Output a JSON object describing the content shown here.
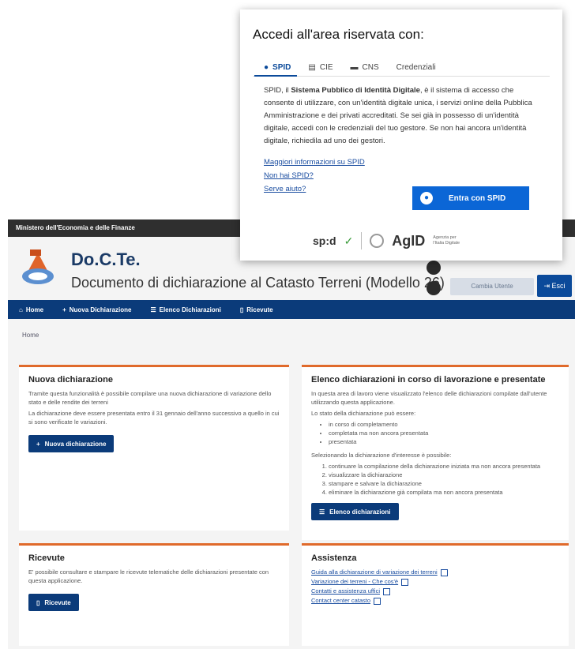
{
  "popup": {
    "title": "Accedi all'area riservata con:",
    "tabs": [
      {
        "label": "SPID",
        "icon": "user-circle-icon"
      },
      {
        "label": "CIE",
        "icon": "id-card-icon"
      },
      {
        "label": "CNS",
        "icon": "card-icon"
      },
      {
        "label": "Credenziali",
        "icon": ""
      }
    ],
    "text_pre": "SPID, il ",
    "text_bold": "Sistema Pubblico di Identità Digitale",
    "text_post": ", è il sistema di accesso che consente di utilizzare, con un'identità digitale unica, i servizi online della Pubblica Amministrazione e dei privati accreditati. Se sei già in possesso di un'identità digitale, accedi con le credenziali del tuo gestore. Se non hai ancora un'identità digitale, richiedila ad uno dei gestori.",
    "links": [
      "Maggiori informazioni su SPID",
      "Non hai SPID?",
      "Serve aiuto?"
    ],
    "login_button": "Entra con SPID",
    "spid_logo": "sp:d",
    "agid_logo": "AgID",
    "agid_sub": "Agenzia per l'Italia Digitale"
  },
  "ministry": "Ministero dell'Economia e delle Finanze",
  "app": {
    "title": "Do.C.Te.",
    "subtitle": "Documento di dichiarazione al Catasto Terreni (Modello 26)",
    "cambia_utente": "Cambia Utente",
    "esci": "Esci"
  },
  "nav": [
    "Home",
    "Nuova Dichiarazione",
    "Elenco Dichiarazioni",
    "Ricevute"
  ],
  "breadcrumb": "Home",
  "cards": {
    "nuova": {
      "title": "Nuova dichiarazione",
      "p1": "Tramite questa funzionalità è possibile compilare una nuova dichiarazione di variazione dello stato e delle rendite dei terreni",
      "p2": "La dichiarazione deve essere presentata entro il 31 gennaio dell'anno successivo a quello in cui si sono verificate le variazioni.",
      "button": "Nuova dichiarazione"
    },
    "elenco": {
      "title": "Elenco dichiarazioni in corso di lavorazione e presentate",
      "p1": "In questa area di lavoro viene visualizzato l'elenco delle dichiarazioni compilate dall'utente utilizzando questa applicazione.",
      "p2": "Lo stato della dichiarazione può essere:",
      "states": [
        "in corso di completamento",
        "completata ma non ancora presentata",
        "presentata"
      ],
      "p3": "Selezionando la dichiarazione d'interesse è possibile:",
      "actions": [
        "continuare la compilazione della dichiarazione iniziata ma non ancora presentata",
        "visualizzare la dichiarazione",
        "stampare e salvare la dichiarazione",
        "eliminare la dichiarazione già compilata ma non ancora presentata"
      ],
      "button": "Elenco dichiarazioni"
    },
    "ricevute": {
      "title": "Ricevute",
      "p1": "E' possibile consultare e stampare le ricevute telematiche delle dichiarazioni presentate con questa applicazione.",
      "button": "Ricevute"
    },
    "assistenza": {
      "title": "Assistenza",
      "links": [
        "Guida alla dichiarazione di variazione dei terreni",
        "Variazione dei terreni - Che cos'è",
        "Contatti e assistenza uffici",
        "Contact center catasto"
      ]
    }
  },
  "colors": {
    "accent": "#e06a2b",
    "nav": "#0b3b7a",
    "spid_button": "#0b66d6"
  }
}
